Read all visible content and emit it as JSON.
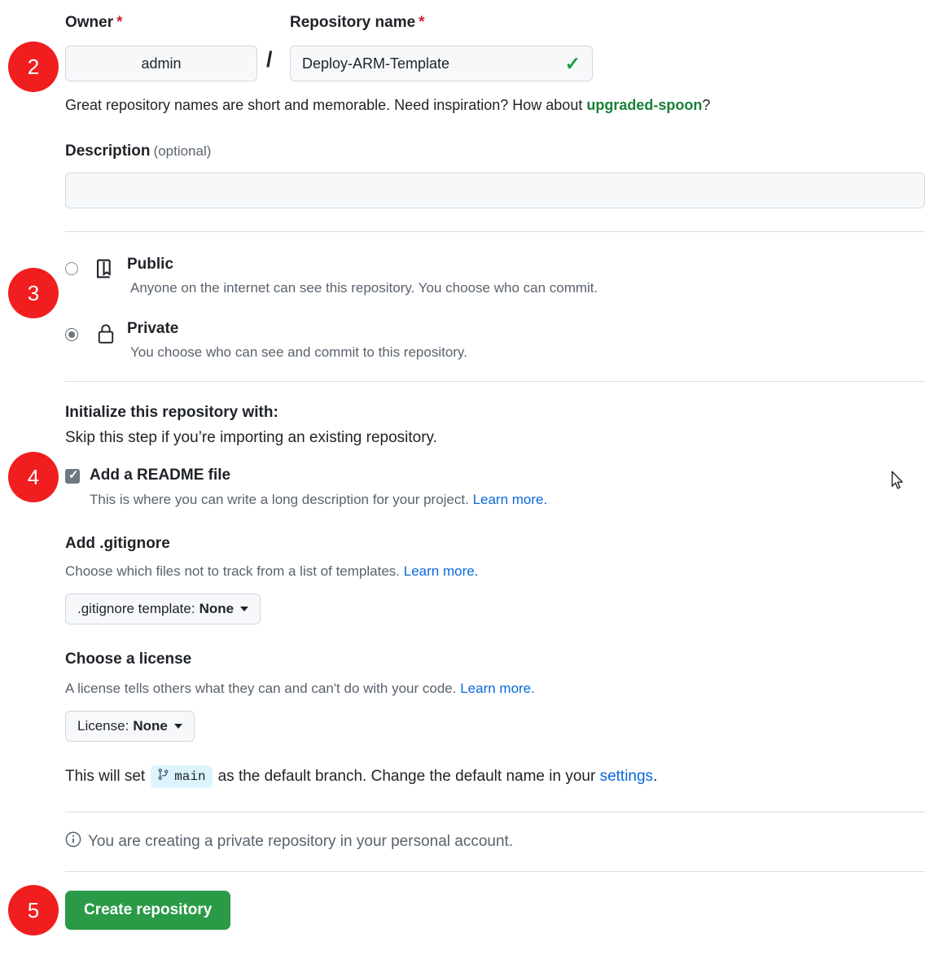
{
  "form": {
    "owner": {
      "label": "Owner",
      "required_mark": "*",
      "value": "admin"
    },
    "separator": "/",
    "repository_name": {
      "label": "Repository name",
      "required_mark": "*",
      "value": "Deploy-ARM-Template",
      "valid_icon": "check-icon"
    },
    "name_hint": {
      "prefix": "Great repository names are short and memorable. Need inspiration? How about ",
      "suggestion": "upgraded-spoon",
      "suffix": "?"
    },
    "description": {
      "label": "Description",
      "optional_note": "(optional)",
      "value": "",
      "placeholder": ""
    },
    "visibility": {
      "public": {
        "title": "Public",
        "description": "Anyone on the internet can see this repository. You choose who can commit.",
        "selected": false,
        "icon": "repo-book-icon"
      },
      "private": {
        "title": "Private",
        "description": "You choose who can see and commit to this repository.",
        "selected": true,
        "icon": "lock-icon"
      }
    },
    "initialize": {
      "heading": "Initialize this repository with:",
      "subheading": "Skip this step if you’re importing an existing repository.",
      "readme": {
        "label": "Add a README file",
        "checked": true,
        "description": "This is where you can write a long description for your project.",
        "learn_more": "Learn more."
      },
      "gitignore": {
        "heading": "Add .gitignore",
        "description": "Choose which files not to track from a list of templates.",
        "learn_more": "Learn more.",
        "dropdown_prefix": ".gitignore template:",
        "dropdown_value": "None"
      },
      "license": {
        "heading": "Choose a license",
        "description": "A license tells others what they can and can't do with your code.",
        "learn_more": "Learn more.",
        "dropdown_prefix": "License:",
        "dropdown_value": "None"
      }
    },
    "branch_note": {
      "prefix": "This will set",
      "branch_icon": "git-branch-icon",
      "branch_name": "main",
      "middle": "as the default branch. Change the default name in your",
      "link": "settings",
      "suffix": "."
    },
    "account_note": {
      "icon": "info-icon",
      "text": "You are creating a private repository in your personal account."
    },
    "submit": {
      "label": "Create repository"
    }
  },
  "annotations": {
    "steps": [
      {
        "number": "2",
        "target": "owner-and-name-fields"
      },
      {
        "number": "3",
        "target": "visibility-options"
      },
      {
        "number": "4",
        "target": "readme-checkbox"
      },
      {
        "number": "5",
        "target": "create-repository-button"
      }
    ]
  },
  "colors": {
    "accent_green": "#2a9a47",
    "badge_red": "#f01e1e",
    "link_blue": "#0969da",
    "suggestion_green": "#1a7f37",
    "required_red": "#cf222e",
    "branch_badge_bg": "#ddf4ff"
  }
}
